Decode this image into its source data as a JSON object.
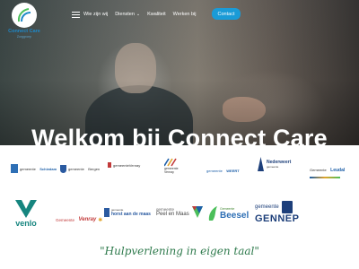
{
  "brand": {
    "name": "Connect Care",
    "subtitle": "Zorggroep"
  },
  "nav": {
    "items": [
      {
        "label": "Wie zijn wij"
      },
      {
        "label": "Diensten"
      },
      {
        "label": "Kwaliteit"
      },
      {
        "label": "Werken bij"
      }
    ],
    "contact_label": "Contact"
  },
  "hero": {
    "title": "Welkom bij Connect Care"
  },
  "municipalities": [
    {
      "main": "Schiedam",
      "prefix": "gemeente"
    },
    {
      "main": "Bergen",
      "prefix": "gemeente"
    },
    {
      "main": "Venray",
      "prefix": "gemeente"
    },
    {
      "main": "Venray",
      "prefix": "gemeente"
    },
    {
      "main": "WEERT",
      "prefix": "gemeente"
    },
    {
      "main": "Nederweert",
      "prefix": "gemeente"
    },
    {
      "main": "Leudal",
      "prefix": "Gemeente"
    },
    {
      "main": "venlo",
      "prefix": ""
    },
    {
      "main": "Venray",
      "prefix": "Gemeente"
    },
    {
      "main": "horst aan de maas",
      "prefix": "gemeente"
    },
    {
      "main": "Peel en Maas",
      "prefix": "gemeente"
    },
    {
      "main": "Beesel",
      "prefix": "Gemeente"
    },
    {
      "main": "GENNEP",
      "prefix": "gemeente"
    }
  ],
  "tagline": "\"Hulpverlening in eigen taal\"",
  "colors": {
    "accent": "#1a9bd7",
    "tagline": "#2e7a4c",
    "venlo": "#16857f"
  }
}
